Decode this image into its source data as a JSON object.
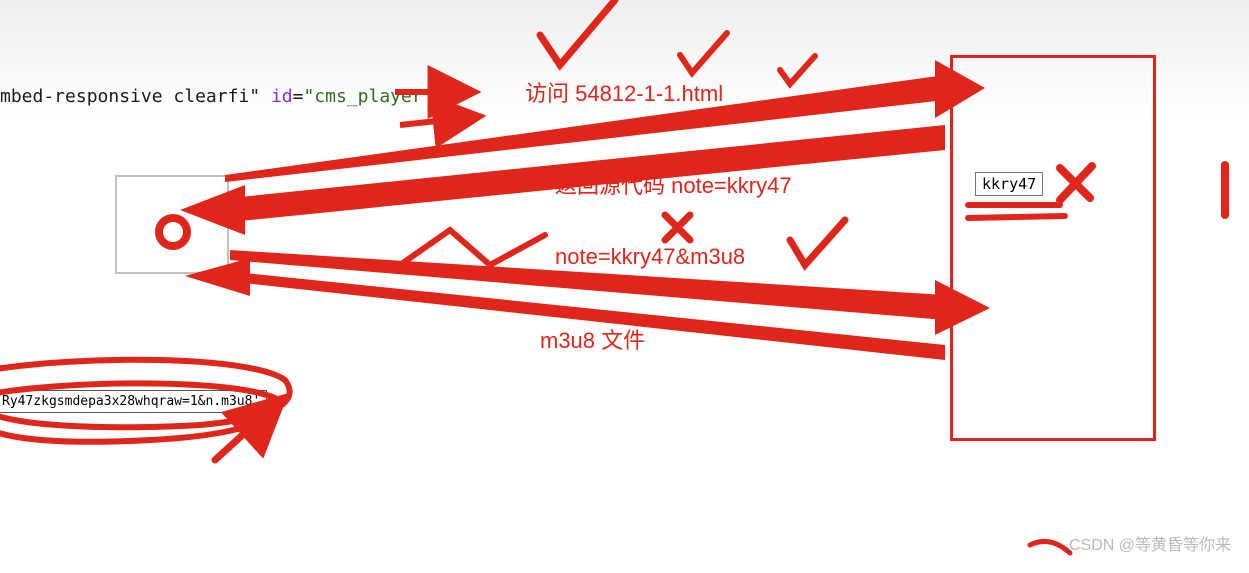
{
  "top_code": {
    "prefix": "mbed-responsive clearfi\" ",
    "attr": "id",
    "eq": "=",
    "value": "\"cms_player\"",
    "suffix": ">"
  },
  "labels": {
    "request1": "访问 54812-1-1.html",
    "response1": "返回源代码  note=kkry47",
    "request2": "note=kkry47&m3u8",
    "response2": "m3u8 文件"
  },
  "server_note": "kkry47",
  "bottom_code": "Ry47zkgsmdepa3x28whqraw=1&n.m3u8'",
  "watermark": "CSDN @等黄昏等你来"
}
